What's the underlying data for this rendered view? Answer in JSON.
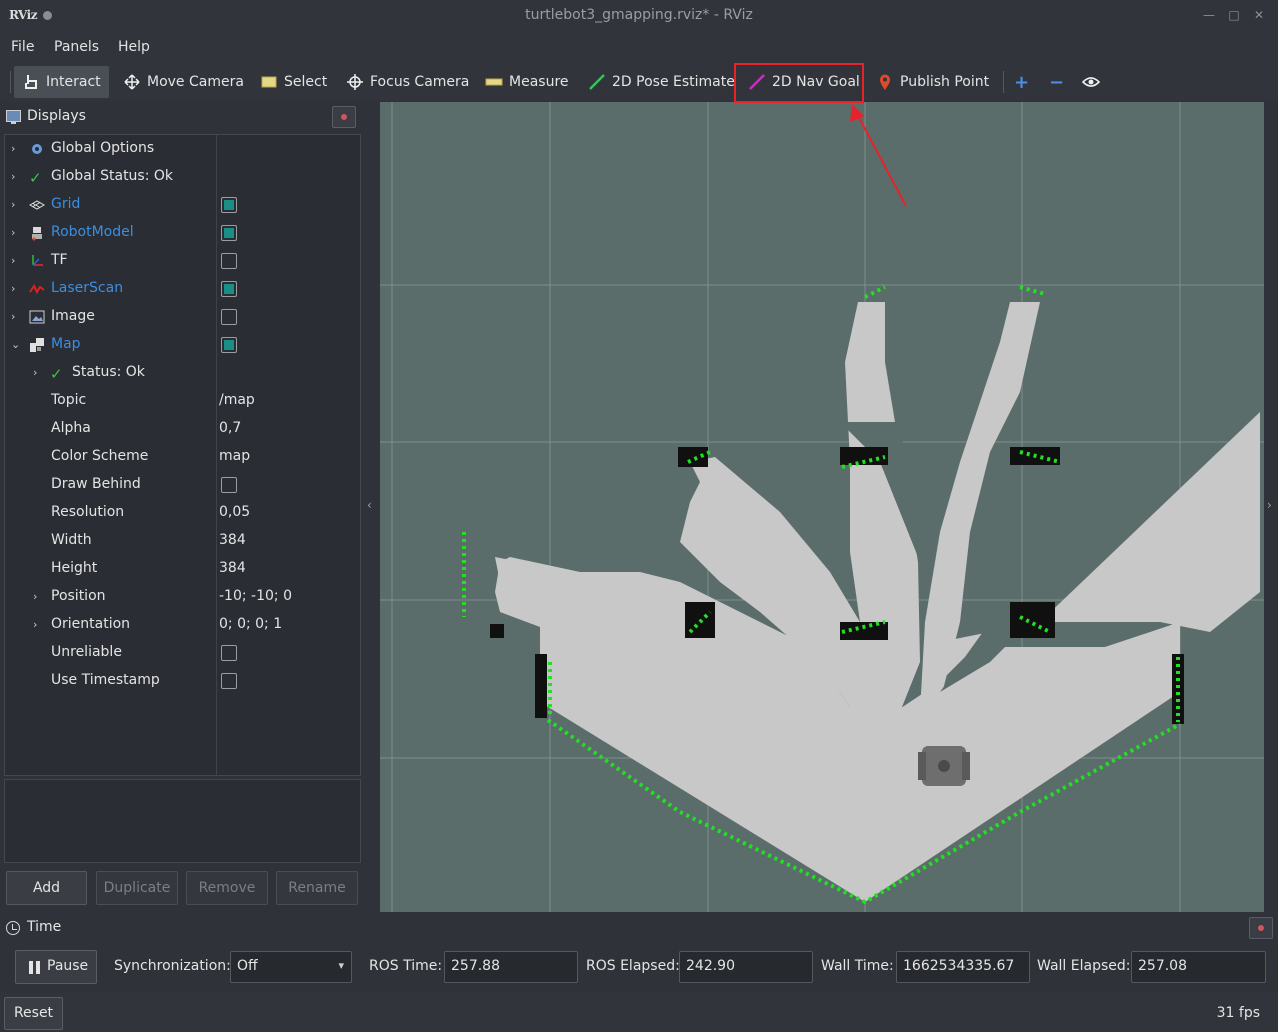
{
  "window": {
    "logo": "RViz",
    "title": "turtlebot3_gmapping.rviz* - RViz"
  },
  "menu": {
    "items": [
      "File",
      "Panels",
      "Help"
    ]
  },
  "toolbar": {
    "tools": [
      "Interact",
      "Move Camera",
      "Select",
      "Focus Camera",
      "Measure",
      "2D Pose Estimate",
      "2D Nav Goal",
      "Publish Point"
    ],
    "active": "Interact",
    "highlighted": "2D Nav Goal",
    "highlight_color": "#e8222a"
  },
  "displays": {
    "title": "Displays",
    "items": [
      {
        "label": "Global Options",
        "icon": "gear-icon"
      },
      {
        "label": "Global Status: Ok",
        "icon": "check-icon"
      },
      {
        "label": "Grid",
        "icon": "grid-icon",
        "checked": true
      },
      {
        "label": "RobotModel",
        "icon": "robot-icon",
        "checked": true
      },
      {
        "label": "TF",
        "icon": "tf-axes-icon",
        "checked": false
      },
      {
        "label": "LaserScan",
        "icon": "laser-icon",
        "checked": true
      },
      {
        "label": "Image",
        "icon": "image-icon",
        "checked": false
      },
      {
        "label": "Map",
        "icon": "map-icon",
        "checked": true
      }
    ],
    "map_props": {
      "status": "Status: Ok",
      "topic_label": "Topic",
      "topic": "/map",
      "alpha_label": "Alpha",
      "alpha": "0,7",
      "color_scheme_label": "Color Scheme",
      "color_scheme": "map",
      "draw_behind_label": "Draw Behind",
      "draw_behind": false,
      "resolution_label": "Resolution",
      "resolution": "0,05",
      "width_label": "Width",
      "width": "384",
      "height_label": "Height",
      "height": "384",
      "position_label": "Position",
      "position": "-10; -10; 0",
      "orientation_label": "Orientation",
      "orientation": "0; 0; 0; 1",
      "unreliable_label": "Unreliable",
      "unreliable": false,
      "use_timestamp_label": "Use Timestamp",
      "use_timestamp": false
    },
    "buttons": {
      "add": "Add",
      "duplicate": "Duplicate",
      "remove": "Remove",
      "rename": "Rename"
    }
  },
  "time": {
    "title": "Time",
    "pause": "Pause",
    "sync_label": "Synchronization:",
    "sync_value": "Off",
    "ros_time_label": "ROS Time:",
    "ros_time": "257.88",
    "ros_elapsed_label": "ROS Elapsed:",
    "ros_elapsed": "242.90",
    "wall_time_label": "Wall Time:",
    "wall_time": "1662534335.67",
    "wall_elapsed_label": "Wall Elapsed:",
    "wall_elapsed": "257.08"
  },
  "status": {
    "reset": "Reset",
    "fps": "31 fps"
  },
  "colors": {
    "free_space": "#c8c8c8",
    "unknown": "#5b6d6b",
    "obstacle": "#111111",
    "laser": "#22e022",
    "link": "#3b8fe0",
    "checked": "#1a8f86"
  }
}
